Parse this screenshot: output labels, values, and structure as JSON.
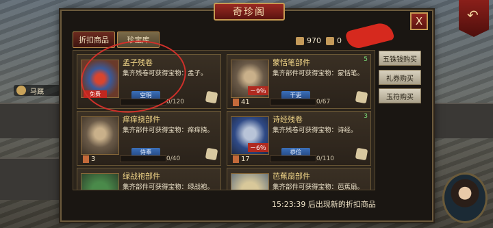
{
  "title": "奇珍阁",
  "close_label": "X",
  "tabs": [
    {
      "label": "折扣商品"
    },
    {
      "label": "珍宝库"
    }
  ],
  "currency": {
    "coins": "970",
    "vouchers": "0"
  },
  "side_buttons": [
    {
      "label": "五铢钱购买"
    },
    {
      "label": "礼券购买"
    },
    {
      "label": "玉符购买"
    }
  ],
  "background": {
    "stable_label": "马厩"
  },
  "items": [
    {
      "name": "孟子残卷",
      "desc": "集齐残卷可获得宝物：孟子。",
      "tag": "空明",
      "badge": "免费",
      "count": "0/120",
      "num": "",
      "discount": "",
      "price": ""
    },
    {
      "name": "蒙恬笔部件",
      "desc": "集齐部件可获得宝物：蒙恬笔。",
      "tag": "干吏",
      "badge": "",
      "count": "0/67",
      "num": "5",
      "discount": "－9％",
      "price": "41"
    },
    {
      "name": "痒痒挠部件",
      "desc": "集齐部件可获得宝物：痒痒挠。",
      "tag": "侍奉",
      "badge": "",
      "count": "0/40",
      "num": "",
      "discount": "",
      "price": "3"
    },
    {
      "name": "诗经残卷",
      "desc": "集齐残卷可获得宝物：诗经。",
      "tag": "恭俭",
      "badge": "",
      "count": "0/110",
      "num": "3",
      "discount": "－6％",
      "price": "17"
    },
    {
      "name": "绿战袍部件",
      "desc": "集齐部件可获得宝物：绿战袍。",
      "tag": "",
      "badge": "",
      "count": "",
      "num": "",
      "discount": "",
      "price": ""
    },
    {
      "name": "芭蕉扇部件",
      "desc": "集齐部件可获得宝物：芭蕉扇。",
      "tag": "",
      "badge": "",
      "count": "",
      "num": "",
      "discount": "",
      "price": ""
    }
  ],
  "footer": "15:23:39  后出现新的折扣商品"
}
